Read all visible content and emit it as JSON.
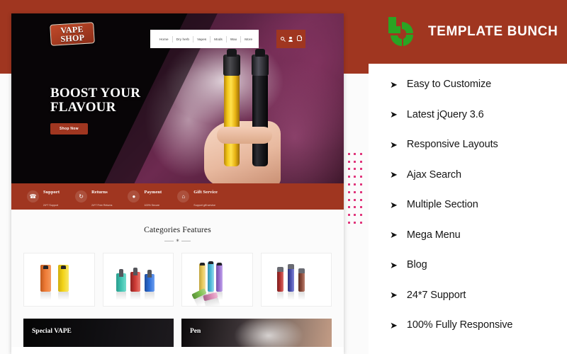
{
  "promo": {
    "background_color": "#a03620",
    "accent_dot_color": "#e0337a"
  },
  "brandbar": {
    "name": "TEMPLATE BUNCH",
    "mark_icon": "template-bunch-b-mark",
    "mark_color": "#2aa423",
    "background_color": "#a03620"
  },
  "features": [
    {
      "arrow": "➤",
      "label": "Easy to Customize"
    },
    {
      "arrow": "➤",
      "label": "Latest jQuery 3.6"
    },
    {
      "arrow": "➤",
      "label": "Responsive Layouts"
    },
    {
      "arrow": "➤",
      "label": "Ajax Search"
    },
    {
      "arrow": "➤",
      "label": "Multiple Section"
    },
    {
      "arrow": "➤",
      "label": "Mega Menu"
    },
    {
      "arrow": "➤",
      "label": "Blog"
    },
    {
      "arrow": "➤",
      "label": "24*7 Support"
    },
    {
      "arrow": "➤",
      "label": "100% Fully Responsive"
    }
  ],
  "site": {
    "logo": {
      "line1": "VAPE",
      "line2": "SHOP"
    },
    "nav": [
      {
        "label": "Home",
        "has_caret": false
      },
      {
        "label": "Dry herb",
        "has_caret": true
      },
      {
        "label": "Vapes",
        "has_caret": true
      },
      {
        "label": "Mods",
        "has_caret": false
      },
      {
        "label": "Wax",
        "has_caret": false
      },
      {
        "label": "More",
        "has_caret": true
      }
    ],
    "nav_icons": [
      {
        "name": "search-icon"
      },
      {
        "name": "user-account-icon"
      },
      {
        "name": "shopping-cart-icon"
      }
    ],
    "hero": {
      "title_line1": "BOOST YOUR",
      "title_line2": "FLAVOUR",
      "cta_label": "Shop Now"
    },
    "services": [
      {
        "icon": "headset-support-icon",
        "glyph": "☎",
        "title": "Support",
        "subtitle": "24*7 Support"
      },
      {
        "icon": "returns-exchange-icon",
        "glyph": "↻",
        "title": "Returns",
        "subtitle": "24*7 Free Returns"
      },
      {
        "icon": "payment-money-icon",
        "glyph": "●",
        "title": "Payment",
        "subtitle": "100% Secure"
      },
      {
        "icon": "gift-box-icon",
        "glyph": "⌂",
        "title": "Gift Service",
        "subtitle": "Support gift service"
      }
    ],
    "categories": {
      "title": "Categories Features",
      "divider_glyph": "✶",
      "cards": [
        {
          "name": "disposable-vape-pair",
          "colors": [
            "#ee7a36",
            "#f3d317"
          ]
        },
        {
          "name": "box-mod-kits",
          "colors": [
            "#3fc2b0",
            "#cf3b36",
            "#2f6fd8"
          ]
        },
        {
          "name": "slim-disposable-set",
          "colors": [
            "#e8c85a",
            "#4fb9d8",
            "#9a6fd0",
            "#7bbf4e",
            "#d98ab5"
          ]
        },
        {
          "name": "vape-pen-trio",
          "colors": [
            "#b3312f",
            "#4a4fae",
            "#8a4a3a"
          ]
        }
      ]
    },
    "banners": [
      {
        "label": "Special VAPE"
      },
      {
        "label": "Pen"
      }
    ]
  }
}
